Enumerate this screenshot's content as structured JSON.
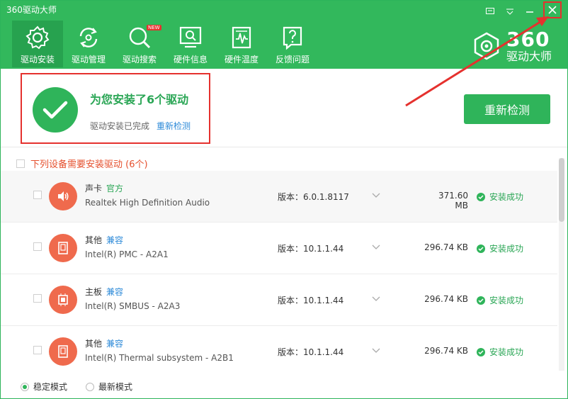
{
  "app": {
    "title": "360驱动大师"
  },
  "toolbar": {
    "items": [
      {
        "label": "驱动安装",
        "icon": "gear-icon"
      },
      {
        "label": "驱动管理",
        "icon": "refresh-icon"
      },
      {
        "label": "驱动搜索",
        "icon": "search-icon"
      },
      {
        "label": "硬件信息",
        "icon": "monitor-search-icon"
      },
      {
        "label": "硬件温度",
        "icon": "thermometer-icon"
      },
      {
        "label": "反馈问题",
        "icon": "question-icon"
      }
    ],
    "new_badge": "NEW"
  },
  "logo": {
    "number": "360",
    "sub": "驱动大师"
  },
  "status": {
    "title": "为您安装了6个驱动",
    "subtitle": "驱动安装已完成",
    "link": "重新检测",
    "button": "重新检测"
  },
  "list": {
    "header": "下列设备需要安装驱动 (6个)",
    "rows": [
      {
        "category": "声卡",
        "tag": "官方",
        "name": "Realtek High Definition Audio",
        "version": "版本：6.0.1.8117",
        "size": "371.60 MB",
        "status": "安装成功"
      },
      {
        "category": "其他",
        "tag": "兼容",
        "name": "Intel(R) PMC - A2A1",
        "version": "版本：10.1.1.44",
        "size": "296.74 KB",
        "status": "安装成功"
      },
      {
        "category": "主板",
        "tag": "兼容",
        "name": "Intel(R) SMBUS - A2A3",
        "version": "版本：10.1.1.44",
        "size": "296.74 KB",
        "status": "安装成功"
      },
      {
        "category": "其他",
        "tag": "兼容",
        "name": "Intel(R) Thermal subsystem - A2B1",
        "version": "版本：10.1.1.44",
        "size": "296.74 KB",
        "status": "安装成功"
      }
    ]
  },
  "footer": {
    "mode_stable": "稳定模式",
    "mode_latest": "最新模式"
  },
  "colors": {
    "accent": "#32b85c",
    "alert": "#e5312e",
    "link": "#2d8ad8"
  }
}
